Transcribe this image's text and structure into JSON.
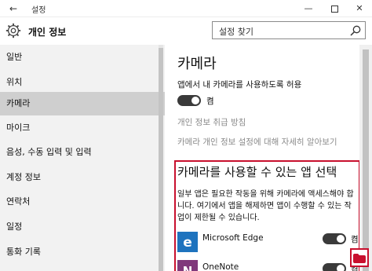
{
  "titlebar": {
    "title": "설정",
    "back_glyph": "←",
    "minimize_glyph": "—",
    "close_glyph": "✕"
  },
  "header": {
    "title": "개인 정보",
    "search_placeholder": "설정 찾기"
  },
  "sidebar": {
    "items": [
      {
        "label": "일반",
        "active": false
      },
      {
        "label": "위치",
        "active": false
      },
      {
        "label": "카메라",
        "active": true
      },
      {
        "label": "마이크",
        "active": false
      },
      {
        "label": "음성, 수동 입력 및 입력",
        "active": false
      },
      {
        "label": "계정 정보",
        "active": false
      },
      {
        "label": "연락처",
        "active": false
      },
      {
        "label": "일정",
        "active": false
      },
      {
        "label": "통화 기록",
        "active": false
      }
    ]
  },
  "main": {
    "title": "카메라",
    "allow_label": "앱에서 내 카메라를 사용하도록 허용",
    "allow_state": "켬",
    "privacy_link": "개인 정보 취급 방침",
    "learn_more_link": "카메라 개인 정보 설정에 대해 자세히 알아보기",
    "section_title": "카메라를 사용할 수 있는 앱 선택",
    "section_desc": "일부 앱은 필요한 작동을 위해 카메라에 액세스해야 합니다. 여기에서 앱을 해제하면 앱이 수행할 수 있는 작업이 제한될 수 있습니다.",
    "apps": [
      {
        "name": "Microsoft Edge",
        "state": "켬",
        "icon": "edge-icon"
      },
      {
        "name": "OneNote",
        "state": "켬",
        "icon": "onenote-icon"
      }
    ]
  },
  "colors": {
    "accent_red": "#c8102e",
    "sidebar_bg": "#f2f2f2",
    "active_item_bg": "#cfcfcf",
    "edge_blue": "#1e73be",
    "onenote_purple": "#80397b"
  }
}
